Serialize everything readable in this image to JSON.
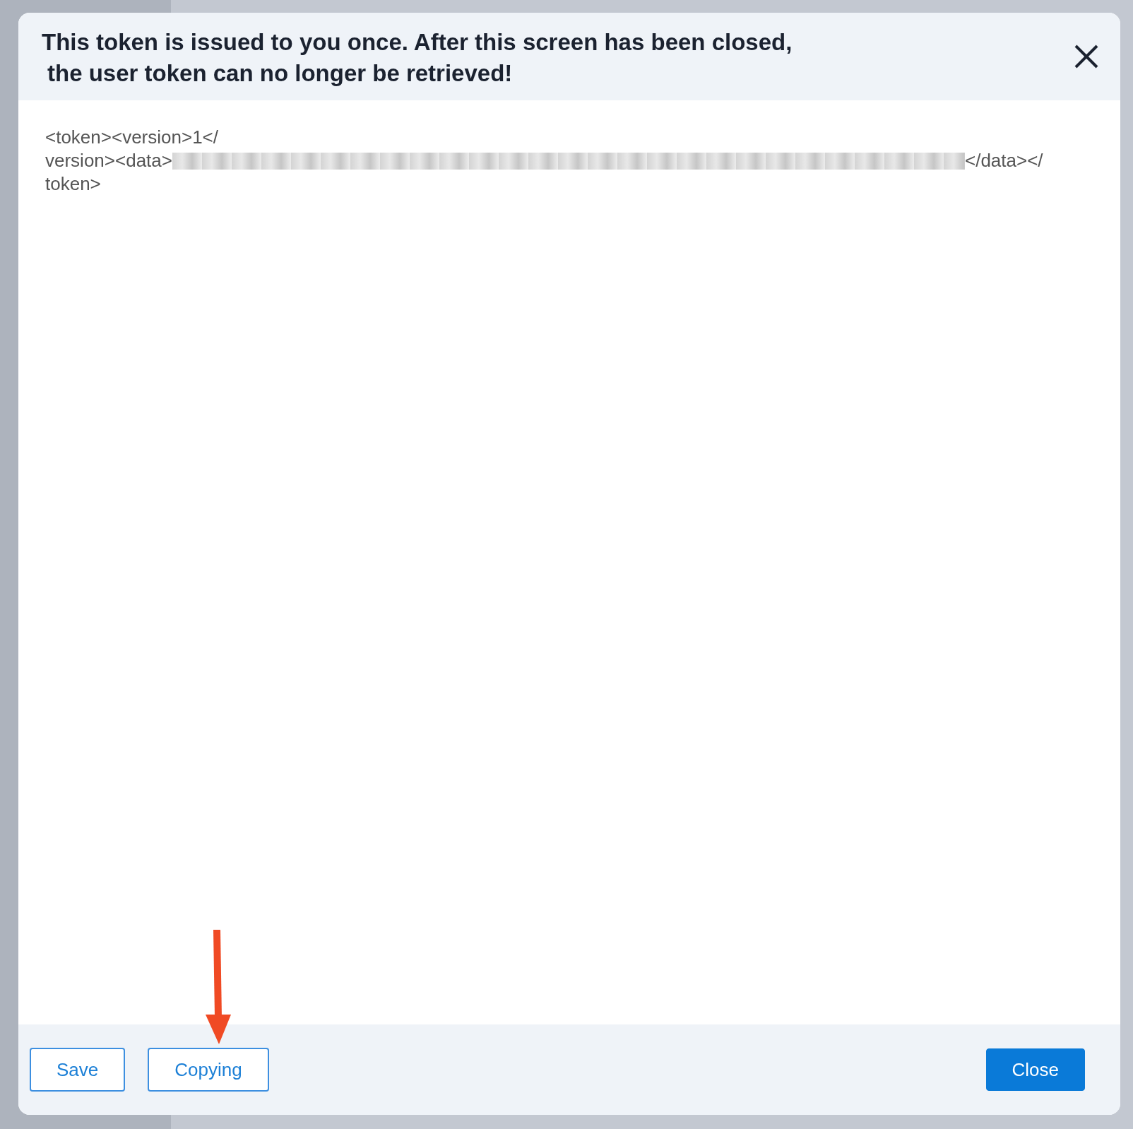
{
  "dialog": {
    "title_lines": [
      "This token is issued to you once. After this screen has been closed,",
      "the user token can no longer be retrieved!"
    ],
    "token": {
      "line_1": "<token><version>1</",
      "line_2_start": "version><data>",
      "line_2_end": "</data></",
      "line_3": "token>"
    },
    "buttons": [
      {
        "label": "Save",
        "kind": "outline"
      },
      {
        "label": "Copying",
        "kind": "outline"
      },
      {
        "label": "Close",
        "kind": "primary"
      }
    ]
  }
}
